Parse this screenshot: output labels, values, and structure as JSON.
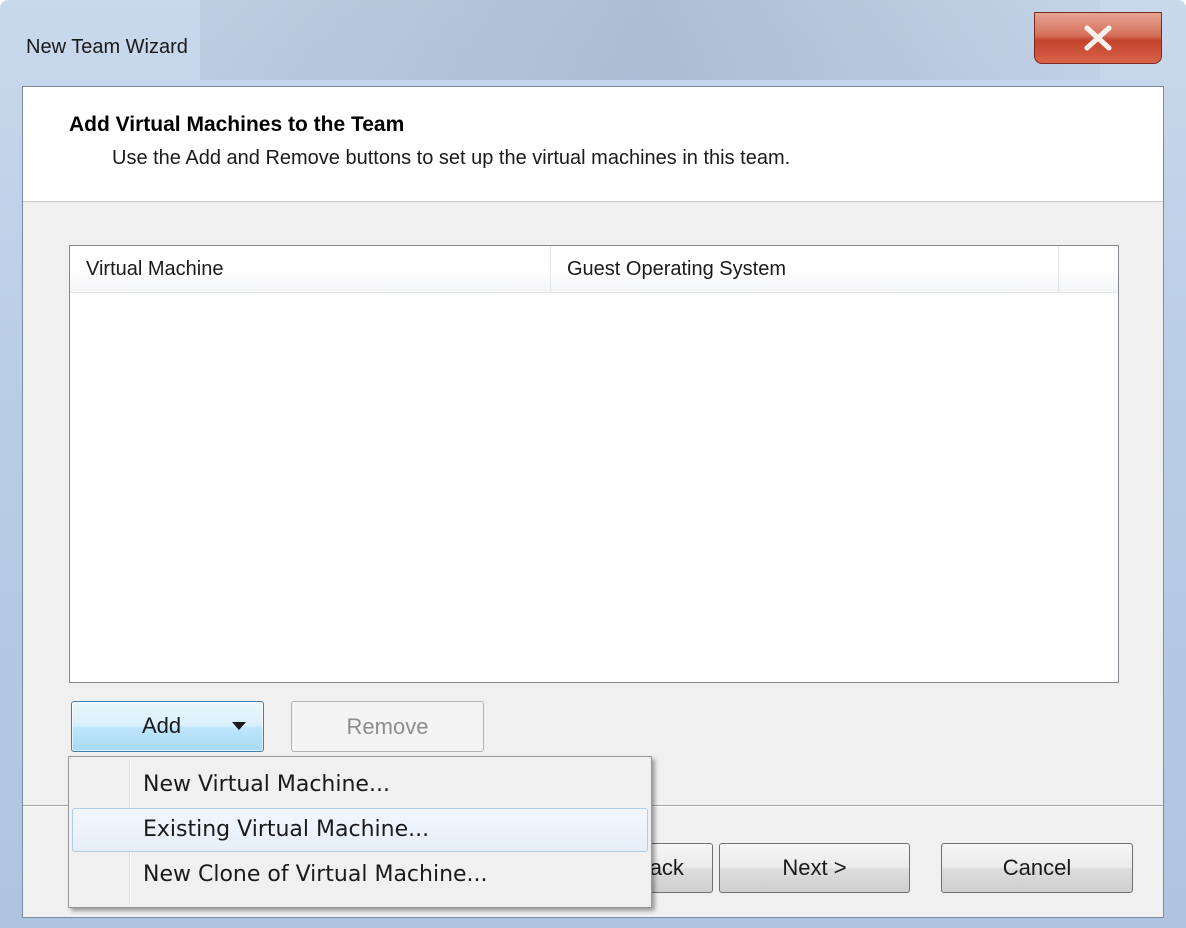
{
  "window": {
    "title": "New Team Wizard"
  },
  "header": {
    "title": "Add Virtual Machines to the Team",
    "subtitle": "Use the Add and Remove buttons to set up the virtual machines in this team."
  },
  "list": {
    "columns": [
      "Virtual Machine",
      "Guest Operating System",
      ""
    ],
    "rows": []
  },
  "buttons": {
    "add": "Add",
    "remove": "Remove",
    "back": "< Back",
    "next": "Next >",
    "cancel": "Cancel"
  },
  "add_menu": {
    "items": [
      "New Virtual Machine...",
      "Existing Virtual Machine...",
      "New Clone of Virtual Machine..."
    ],
    "highlighted_index": 1
  },
  "colors": {
    "close_button": "#c3432a",
    "menu_highlight": "#e6eefa",
    "add_button_active": "#bee6fd"
  },
  "icons": {
    "close": "close-x-icon",
    "dropdown": "dropdown-arrow-icon"
  }
}
